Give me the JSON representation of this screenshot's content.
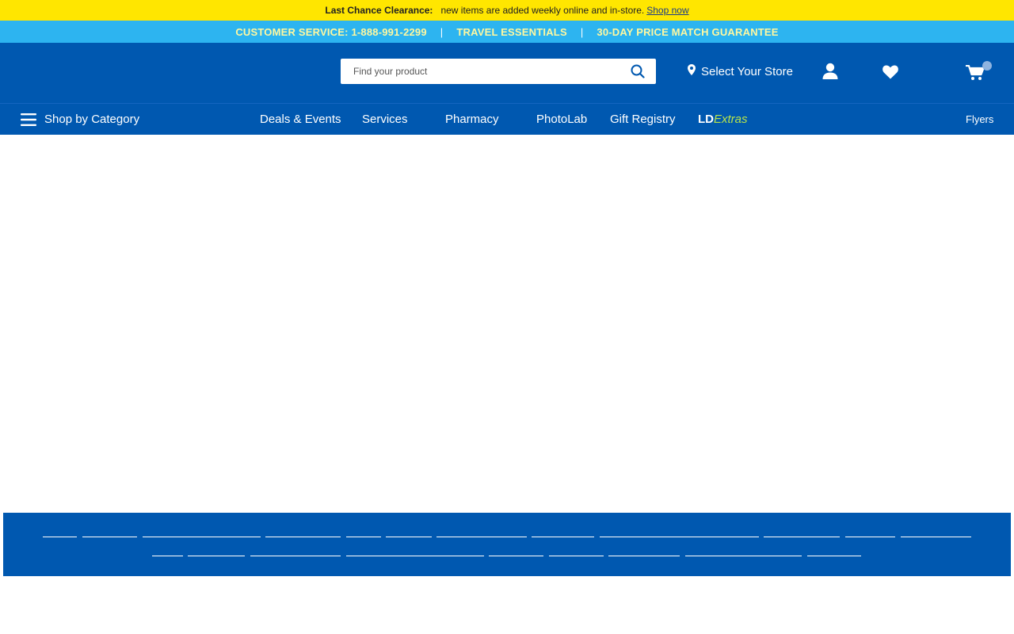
{
  "promo": {
    "title": "Last Chance Clearance:",
    "text": "new items are added weekly online and in-store.",
    "link": "Shop now"
  },
  "service_bar": {
    "customer_service": "CUSTOMER SERVICE: 1-888-991-2299",
    "separator": "|",
    "travel": "TRAVEL ESSENTIALS",
    "price_match": "30-DAY PRICE MATCH GUARANTEE"
  },
  "header": {
    "search_placeholder": "Find your product",
    "store_label": "Select Your Store",
    "icons": [
      "search-icon",
      "map-pin-icon",
      "user-icon",
      "heart-icon",
      "cart-icon"
    ]
  },
  "nav": {
    "category": "Shop by Category",
    "deals": "Deals & Events",
    "services": "Services",
    "pharmacy": "Pharmacy",
    "photolab": "PhotoLab",
    "registry": "Gift Registry",
    "ld": "LD",
    "extras": "Extras",
    "flyers": "Flyers"
  },
  "colors": {
    "promo_bg": "#ffe600",
    "service_bg": "#2db4f0",
    "brand_blue": "#0058b0",
    "extras_green": "#b7e34a"
  }
}
